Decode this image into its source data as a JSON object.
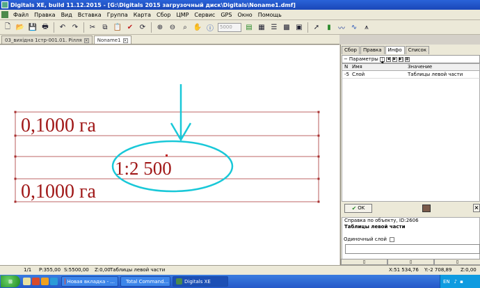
{
  "window": {
    "title": "Digitals XE, build 11.12.2015 - [G:\\Digitals 2015 загрузочный диск\\Digitals\\Noname1.dmf]"
  },
  "menu": [
    "Файл",
    "Правка",
    "Вид",
    "Вставка",
    "Группа",
    "Карта",
    "Сбор",
    "ЦМР",
    "Сервис",
    "GPS",
    "Окно",
    "Помощь"
  ],
  "toolbar": {
    "scale_field": "5000"
  },
  "doc_tabs": [
    {
      "label": "03_вихідна 1стр-001.01. Рілля"
    },
    {
      "label": "Noname1"
    }
  ],
  "canvas": {
    "area_top": "0,1000 га",
    "area_bottom": "0,1000 га",
    "scale_label": "1:2 500",
    "line_color": "#a83232",
    "annotation_color": "#19c8d8"
  },
  "panel": {
    "tabs": [
      "Сбор",
      "Правка",
      "Инфо",
      "Список"
    ],
    "active_tab": "Инфо",
    "params_label": "Параметры",
    "grid_headers": [
      "N",
      "Имя",
      "Значение"
    ],
    "grid_rows": [
      {
        "n": "-5",
        "name": "Слой",
        "value": "Таблицы левой части"
      }
    ],
    "ok_label": "OK",
    "reference_label": "Справка по объекту, ID:2606",
    "reference_value": "Таблицы левой части",
    "single_layer_label": "Одиночный слой"
  },
  "status": {
    "page": "1/1",
    "perimeter": "P:355,00",
    "area": "S:5500,00",
    "z": "Z:0,00",
    "layer": "Таблицы левой части",
    "x": "X:51 534,76",
    "y": "Y:-2 708,89",
    "z_right": "Z:0,00"
  },
  "taskbar": {
    "tasks": [
      {
        "label": "Новая вкладка - ..."
      },
      {
        "label": "Total Command..."
      },
      {
        "label": "Digitals XE"
      }
    ],
    "lang": "EN"
  }
}
